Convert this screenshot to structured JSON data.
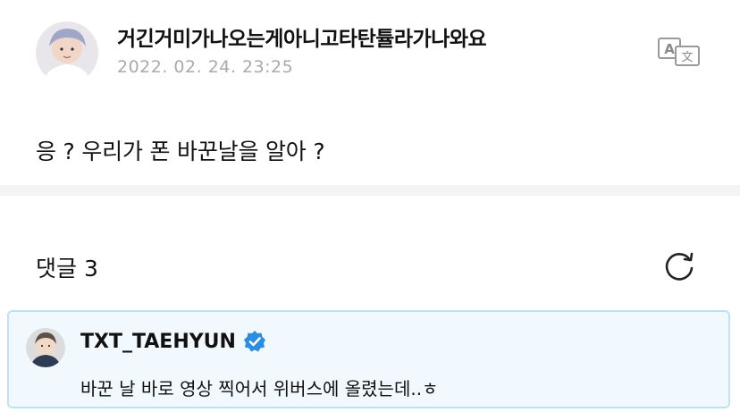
{
  "post": {
    "author_name": "거긴거미가나오는게아니고타탄튤라가나와요",
    "date": "2022. 02. 24. 23:25",
    "body": "응 ? 우리가 폰 바꾼날을 알아 ?",
    "translate_icon": "translate-icon"
  },
  "comments": {
    "count_label": "댓글 3",
    "refresh_icon": "refresh-icon",
    "items": [
      {
        "author": "TXT_TAEHYUN",
        "verified_icon": "verified-badge-icon",
        "text": "바꾼 날 바로 영상 찍어서 위버스에 올렸는데..ㅎ"
      }
    ]
  },
  "colors": {
    "date_gray": "#aaaaaa",
    "divider": "#f4f4f6",
    "comment_border": "#bfe1f6",
    "comment_bg": "#f2f9fe",
    "verified_blue": "#2b8ee0"
  }
}
